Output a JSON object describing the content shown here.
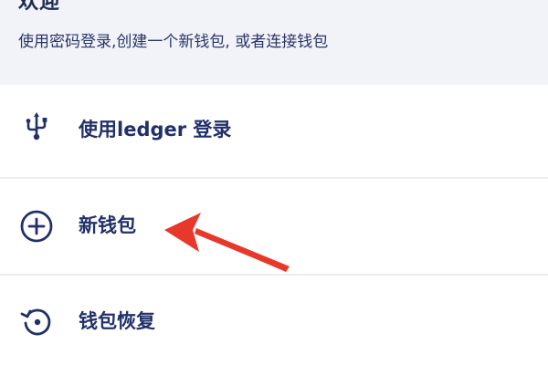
{
  "header": {
    "title": "欢迎",
    "subtitle": "使用密码登录,创建一个新钱包, 或者连接钱包"
  },
  "menu": {
    "items": [
      {
        "label": "使用ledger 登录",
        "icon": "usb-icon"
      },
      {
        "label": "新钱包",
        "icon": "plus-circle-icon"
      },
      {
        "label": "钱包恢复",
        "icon": "restore-icon"
      }
    ]
  },
  "annotation": {
    "arrow_color": "#e8372b",
    "points_to": "新钱包"
  },
  "colors": {
    "header_bg": "#f1f3f8",
    "text_primary": "#22306a",
    "divider": "#eceef3"
  }
}
